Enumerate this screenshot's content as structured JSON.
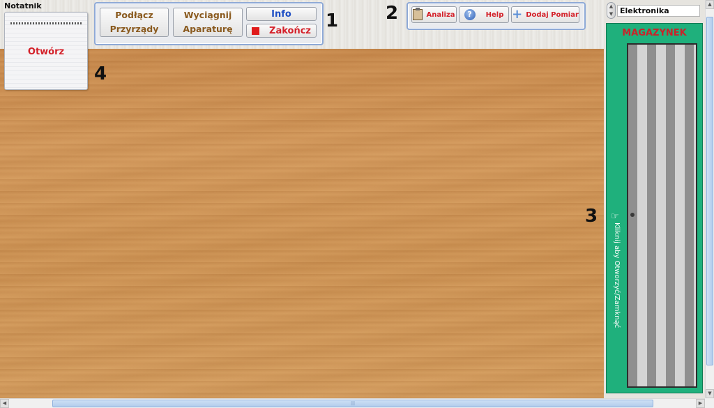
{
  "notepad": {
    "title": "Notatnik",
    "open_label": "Otwórz"
  },
  "toolbar1": {
    "connect_label_line1": "Podłącz",
    "connect_label_line2": "Przyrządy",
    "extract_label_line1": "Wyciągnij",
    "extract_label_line2": "Aparaturę",
    "info_label": "Info",
    "quit_label": "Zakończ"
  },
  "toolbar2": {
    "analysis_label": "Analiza",
    "help_label": "Help",
    "add_measurement_label": "Dodaj Pomiar"
  },
  "markers": {
    "m1": "1",
    "m2": "2",
    "m3": "3",
    "m4": "4"
  },
  "category_select": {
    "value": "Elektronika"
  },
  "storage": {
    "title": "MAGAZYNEK",
    "hint": "Kliknij aby Otworzyć/Zamknąć"
  },
  "colors": {
    "accent_red": "#d4212a",
    "info_blue": "#1f4fc4",
    "button_brown": "#8a5a1e",
    "storage_green": "#1fb07c",
    "group_border": "#8ea9d6"
  },
  "icons": {
    "analysis": "clipboard-icon",
    "help": "question-mark-icon",
    "add": "plus-icon",
    "stop": "stop-square-icon",
    "hand": "pointing-hand-icon"
  }
}
